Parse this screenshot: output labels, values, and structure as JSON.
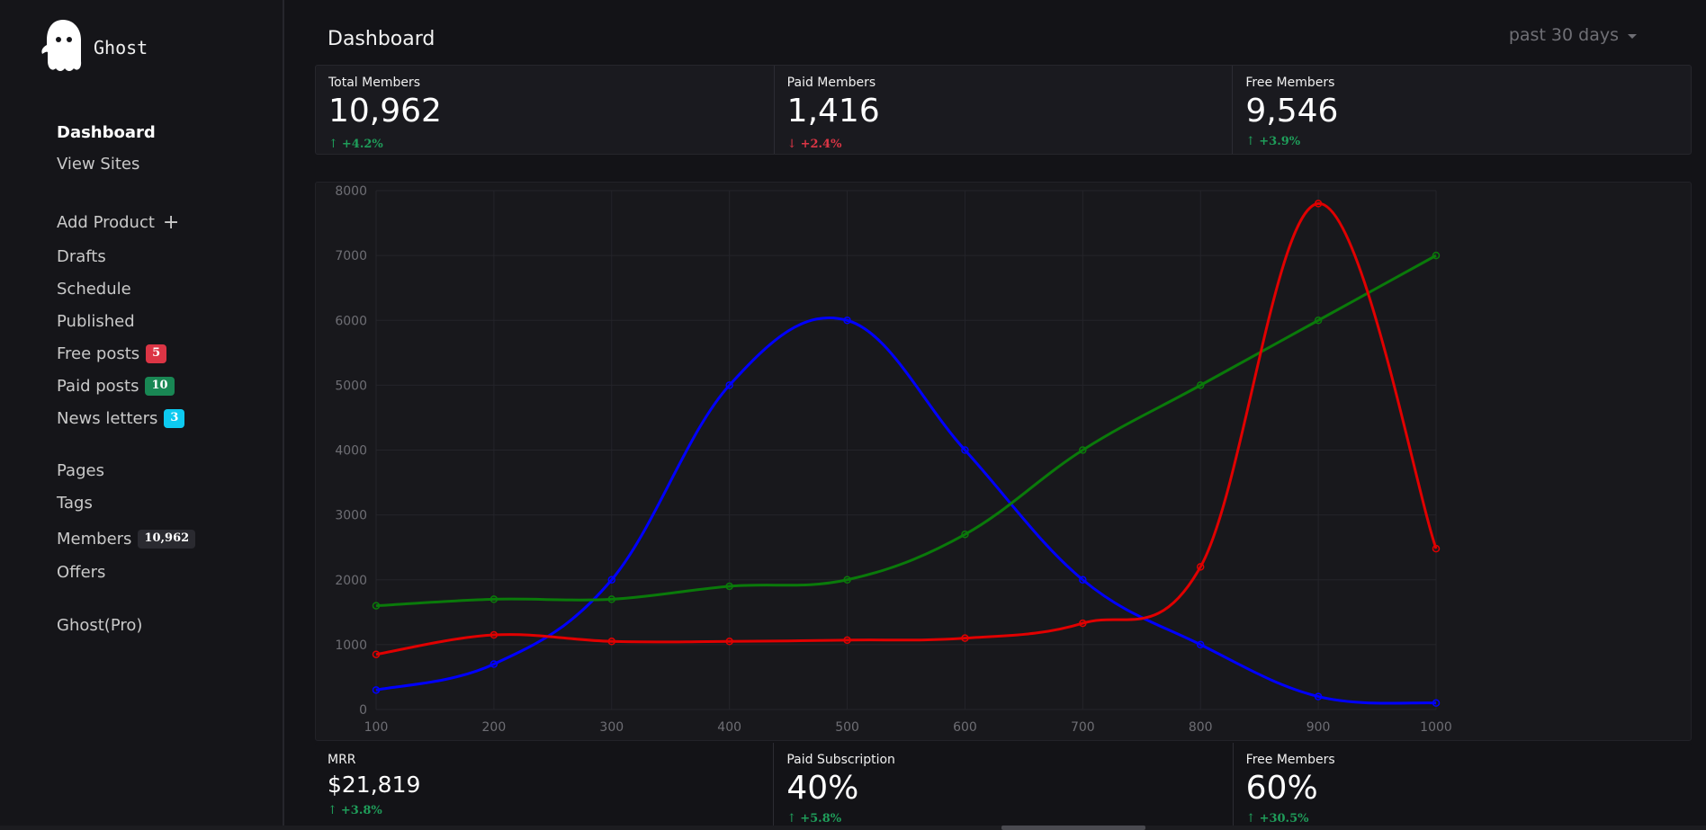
{
  "app": {
    "brand": "Ghost"
  },
  "sidebar": {
    "items": [
      {
        "label": "Dashboard"
      },
      {
        "label": "View Sites"
      },
      {
        "label": "Add Product"
      },
      {
        "label": "Drafts"
      },
      {
        "label": "Schedule"
      },
      {
        "label": "Published"
      },
      {
        "label": "Free posts",
        "badge": "5"
      },
      {
        "label": "Paid posts",
        "badge": "10"
      },
      {
        "label": "News letters",
        "badge": "3"
      },
      {
        "label": "Pages"
      },
      {
        "label": "Tags"
      },
      {
        "label": "Members",
        "badge": "10,962"
      },
      {
        "label": "Offers"
      },
      {
        "label": "Ghost(Pro)"
      }
    ]
  },
  "colors": {
    "badge_red": "#dc3545",
    "badge_green": "#198754",
    "badge_cyan": "#0dcaf0",
    "badge_dark": "#2a2a30",
    "positive": "#1f9d5a",
    "negative": "#dc3545",
    "series_blue": "#0000ff",
    "series_green": "#0a7a0a",
    "series_red": "#e00000"
  },
  "header": {
    "title": "Dashboard",
    "range": "past 30 days"
  },
  "stats_top": [
    {
      "label": "Total Members",
      "value": "10,962",
      "delta": "+4.2%",
      "arrow": "↑"
    },
    {
      "label": "Paid Members",
      "value": "1,416",
      "delta": "+2.4%",
      "arrow": "↓"
    },
    {
      "label": "Free Members",
      "value": "9,546",
      "delta": "+3.9%",
      "arrow": "↑"
    }
  ],
  "stats_bottom": [
    {
      "label": "MRR",
      "value": "$21,819",
      "delta": "+3.8%",
      "arrow": "↑"
    },
    {
      "label": "Paid Subscription",
      "value": "40%",
      "delta": "+5.8%",
      "arrow": "↑"
    },
    {
      "label": "Free Members",
      "value": "60%",
      "delta": "+30.5%",
      "arrow": "↑"
    }
  ],
  "chart_data": {
    "type": "line",
    "x": [
      100,
      200,
      300,
      400,
      500,
      600,
      700,
      800,
      900,
      1000
    ],
    "xlim": [
      100,
      1000
    ],
    "ylim": [
      0,
      8000
    ],
    "yticks": [
      0,
      1000,
      2000,
      3000,
      4000,
      5000,
      6000,
      7000,
      8000
    ],
    "xticks": [
      100,
      200,
      300,
      400,
      500,
      600,
      700,
      800,
      900,
      1000
    ],
    "grid": true,
    "series": [
      {
        "color": "#0000ff",
        "values": [
          300,
          700,
          2000,
          5000,
          6000,
          4000,
          2000,
          1000,
          200,
          100
        ]
      },
      {
        "color": "#0a7a0a",
        "values": [
          1600,
          1700,
          1700,
          1900,
          2000,
          2700,
          4000,
          5000,
          6000,
          7000
        ]
      },
      {
        "color": "#e00000",
        "values": [
          850,
          1150,
          1050,
          1050,
          1070,
          1100,
          1330,
          2200,
          7800,
          2480
        ]
      }
    ]
  }
}
